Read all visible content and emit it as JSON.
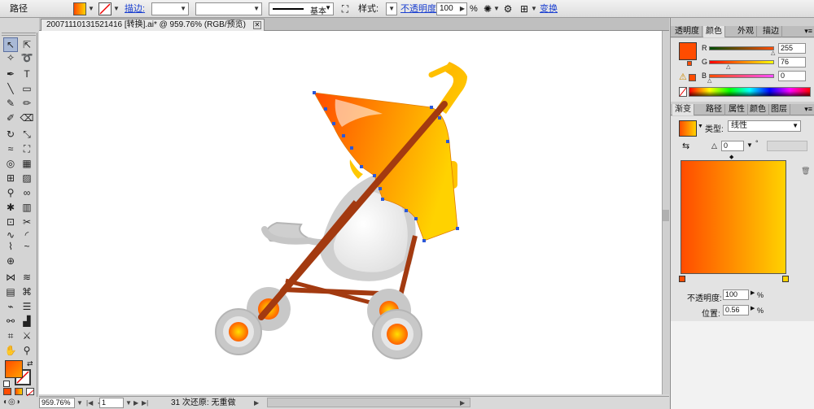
{
  "control_bar": {
    "object_type": "路径",
    "stroke_label": "描边:",
    "brush_label": "基本",
    "style_label": "样式:",
    "opacity_label": "不透明度:",
    "opacity_value": "100",
    "opacity_unit": "%",
    "transform_label": "变换"
  },
  "document": {
    "tab_title": "20071110131521416 [转换].ai* @ 959.76% (RGB/预览)"
  },
  "status_bar": {
    "zoom": "959.76%",
    "page": "1",
    "message": "31 次还原: 无重做"
  },
  "color_panel": {
    "tabs": [
      "透明度",
      "颜色",
      "外观",
      "描边"
    ],
    "active_tab": "颜色",
    "channels": [
      {
        "name": "R",
        "value": "255"
      },
      {
        "name": "G",
        "value": "76"
      },
      {
        "name": "B",
        "value": "0"
      }
    ],
    "current_color": "#ff4c00"
  },
  "gradient_panel": {
    "tabs": [
      "渐变",
      "路径",
      "属性",
      "颜色",
      "图层"
    ],
    "active_tab": "渐变",
    "type_label": "类型:",
    "type_value": "线性",
    "angle_value": "0",
    "angle_unit": "°",
    "opacity_label": "不透明度:",
    "opacity_value": "100",
    "opacity_unit": "%",
    "location_label": "位置:",
    "location_value": "0.56",
    "location_unit": "%",
    "stops": [
      "#ff4c00",
      "#ffd200"
    ]
  },
  "colors": {
    "orange": "#ff4c00",
    "yellow": "#ffd200",
    "frame": "#a33a10",
    "wheel_gray": "#c8c8c8"
  }
}
